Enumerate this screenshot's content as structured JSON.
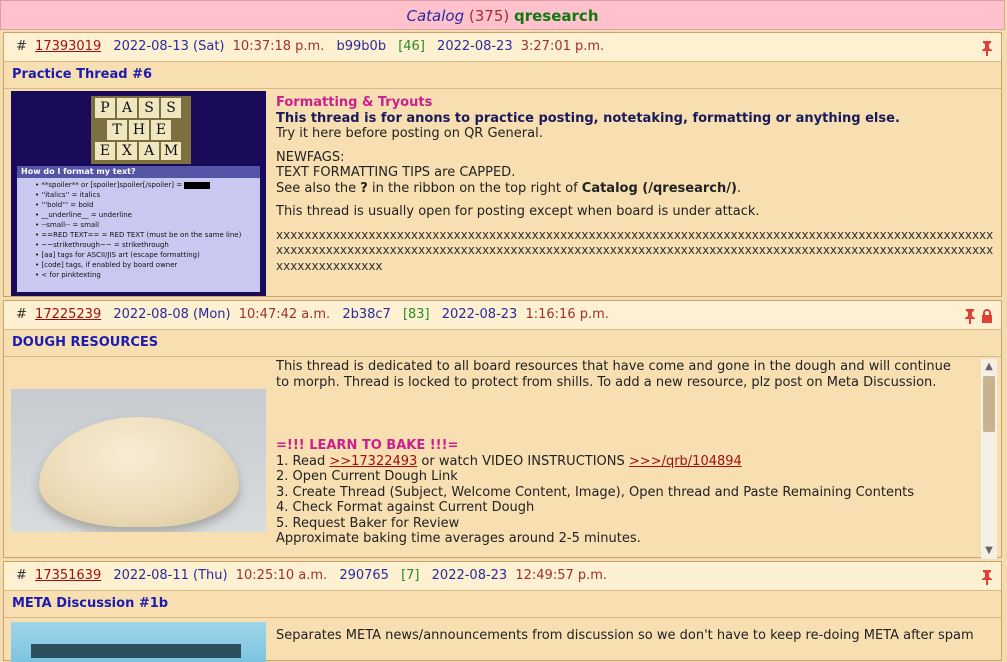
{
  "catalog": {
    "label": "Catalog",
    "count": "(375)",
    "board": "qresearch"
  },
  "threads": [
    {
      "hash": "#",
      "id": "17393019",
      "date": "2022-08-13 (Sat)",
      "time": "10:37:18 p.m.",
      "uid": "b99b0b",
      "replies": "[46]",
      "last_date": "2022-08-23",
      "last_time": "3:27:01 p.m.",
      "subject": "Practice Thread #6",
      "thumb": {
        "tiles_row1": [
          "P",
          "A",
          "S",
          "S"
        ],
        "tiles_row2": [
          "T",
          "H",
          "E"
        ],
        "tiles_row3": [
          "E",
          "X",
          "A",
          "M"
        ],
        "help_title": "How do I format my text?",
        "help_lines": [
          "**spoiler** or [spoiler]spoiler[/spoiler] =",
          "''italics'' = italics",
          "'''bold''' = bold",
          "__underline__ = underline",
          "--small-- = small",
          "==RED TEXT== = RED TEXT (must be on the same line)",
          "~~strikethrough~~ = strikethrough",
          "[aa] tags for ASCII/JIS art (escape formatting)",
          "[code] tags, if enabled by board owner",
          "< for pinktexting"
        ]
      },
      "lines": {
        "l1": "Formatting & Tryouts",
        "l2": "This thread is for anons to practice posting, notetaking,  formatting or anything else.",
        "l3": "Try it here before posting on QR General.",
        "l4": "NEWFAGS:",
        "l5": "TEXT FORMATTING TIPS are CAPPED.",
        "l6a": "See also the ",
        "l6b": "?",
        "l6c": " in the ribbon on the top right of  ",
        "l6d": "Catalog (/qresearch/)",
        "l6e": ".",
        "l7": "This thread is usually open for posting except when board is under attack.",
        "xs": "xxxxxxxxxxxxxxxxxxxxxxxxxxxxxxxxxxxxxxxxxxxxxxxxxxxxxxxxxxxxxxxxxxxxxxxxxxxxxxxxxxxxxxxxxxxxxxxxxxxxxxxxxxxxxxxxxxxxxxxxxxxxxxxxxxxxxxxxxxxxxxxxxxxxxxxxxxxxxxxxxxxxxxxxxxxxxxxxxxxxxxxxxxxxxxxxxxxxxxxxxxxxxxxxxxxxxxxxx"
      }
    },
    {
      "hash": "#",
      "id": "17225239",
      "date": "2022-08-08 (Mon)",
      "time": "10:47:42 a.m.",
      "uid": "2b38c7",
      "replies": "[83]",
      "last_date": "2022-08-23",
      "last_time": "1:16:16 p.m.",
      "subject": "DOUGH RESOURCES",
      "lines": {
        "l1": "This thread is dedicated to all board resources that have come and gone in the dough and will continue",
        "l2": "to morph. Thread is locked to protect from shills. To add a new resource, plz post on Meta Discussion.",
        "l3": "=!!! LEARN TO BAKE !!!=",
        "l4a": "1. Read ",
        "l4b": ">>17322493",
        "l4c": " or watch VIDEO INSTRUCTIONS ",
        "l4d": ">>>/qrb/104894",
        "l5": "2. Open Current Dough Link",
        "l6": "3. Create Thread  (Subject, Welcome Content, Image), Open thread and Paste Remaining Contents",
        "l7": "4. Check Format against Current Dough",
        "l8": "5. Request Baker for Review",
        "l9": "Approximate baking time averages around 2-5 minutes."
      }
    },
    {
      "hash": "#",
      "id": "17351639",
      "date": "2022-08-11 (Thu)",
      "time": "10:25:10 a.m.",
      "uid": "290765",
      "replies": "[7]",
      "last_date": "2022-08-23",
      "last_time": "12:49:57 p.m.",
      "subject": "META Discussion #1b",
      "lines": {
        "l1": "Separates META news/announcements from discussion so we don't have to keep re-doing META after spam"
      }
    }
  ],
  "colors": {
    "topbar": "#ffc1cc",
    "page": "#f5dcb0",
    "header": "#fdf1d2",
    "accent_blue": "#1b1bb0",
    "pink": "#cc1f8f",
    "pin": "#e0403a"
  },
  "icons": [
    "pin-icon",
    "lock-icon",
    "scroll-up-arrow",
    "scroll-down-arrow"
  ]
}
